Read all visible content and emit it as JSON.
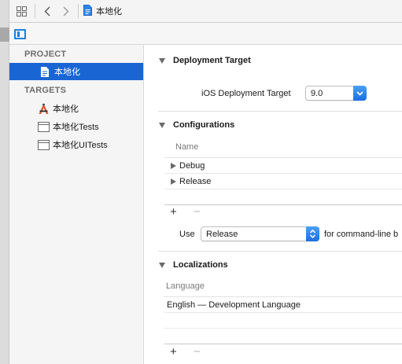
{
  "jumpbar": {
    "grid_icon": "grid-icon",
    "back_icon": "chevron-left-icon",
    "forward_icon": "chevron-right-icon",
    "file_icon": "project-file-icon",
    "crumb_label": "本地化"
  },
  "editor": {
    "toggle_icon": "sidebar-toggle-icon"
  },
  "sidebar": {
    "project_header": "PROJECT",
    "project_item": "本地化",
    "targets_header": "TARGETS",
    "targets": [
      {
        "label": "本地化",
        "icon": "app-target-icon"
      },
      {
        "label": "本地化Tests",
        "icon": "folder-icon"
      },
      {
        "label": "本地化UITests",
        "icon": "folder-icon"
      }
    ]
  },
  "deployment": {
    "title": "Deployment Target",
    "ios_label": "iOS Deployment Target",
    "ios_value": "9.0"
  },
  "configurations": {
    "title": "Configurations",
    "column": "Name",
    "rows": [
      "Debug",
      "Release"
    ],
    "add": "+",
    "remove": "−",
    "use_label": "Use",
    "use_value": "Release",
    "use_suffix": "for command-line b"
  },
  "localizations": {
    "title": "Localizations",
    "column": "Language",
    "rows": [
      "English — Development Language"
    ],
    "add": "+",
    "remove": "−"
  },
  "colors": {
    "selection": "#1a65d4",
    "accent": "#1d7fe2"
  }
}
